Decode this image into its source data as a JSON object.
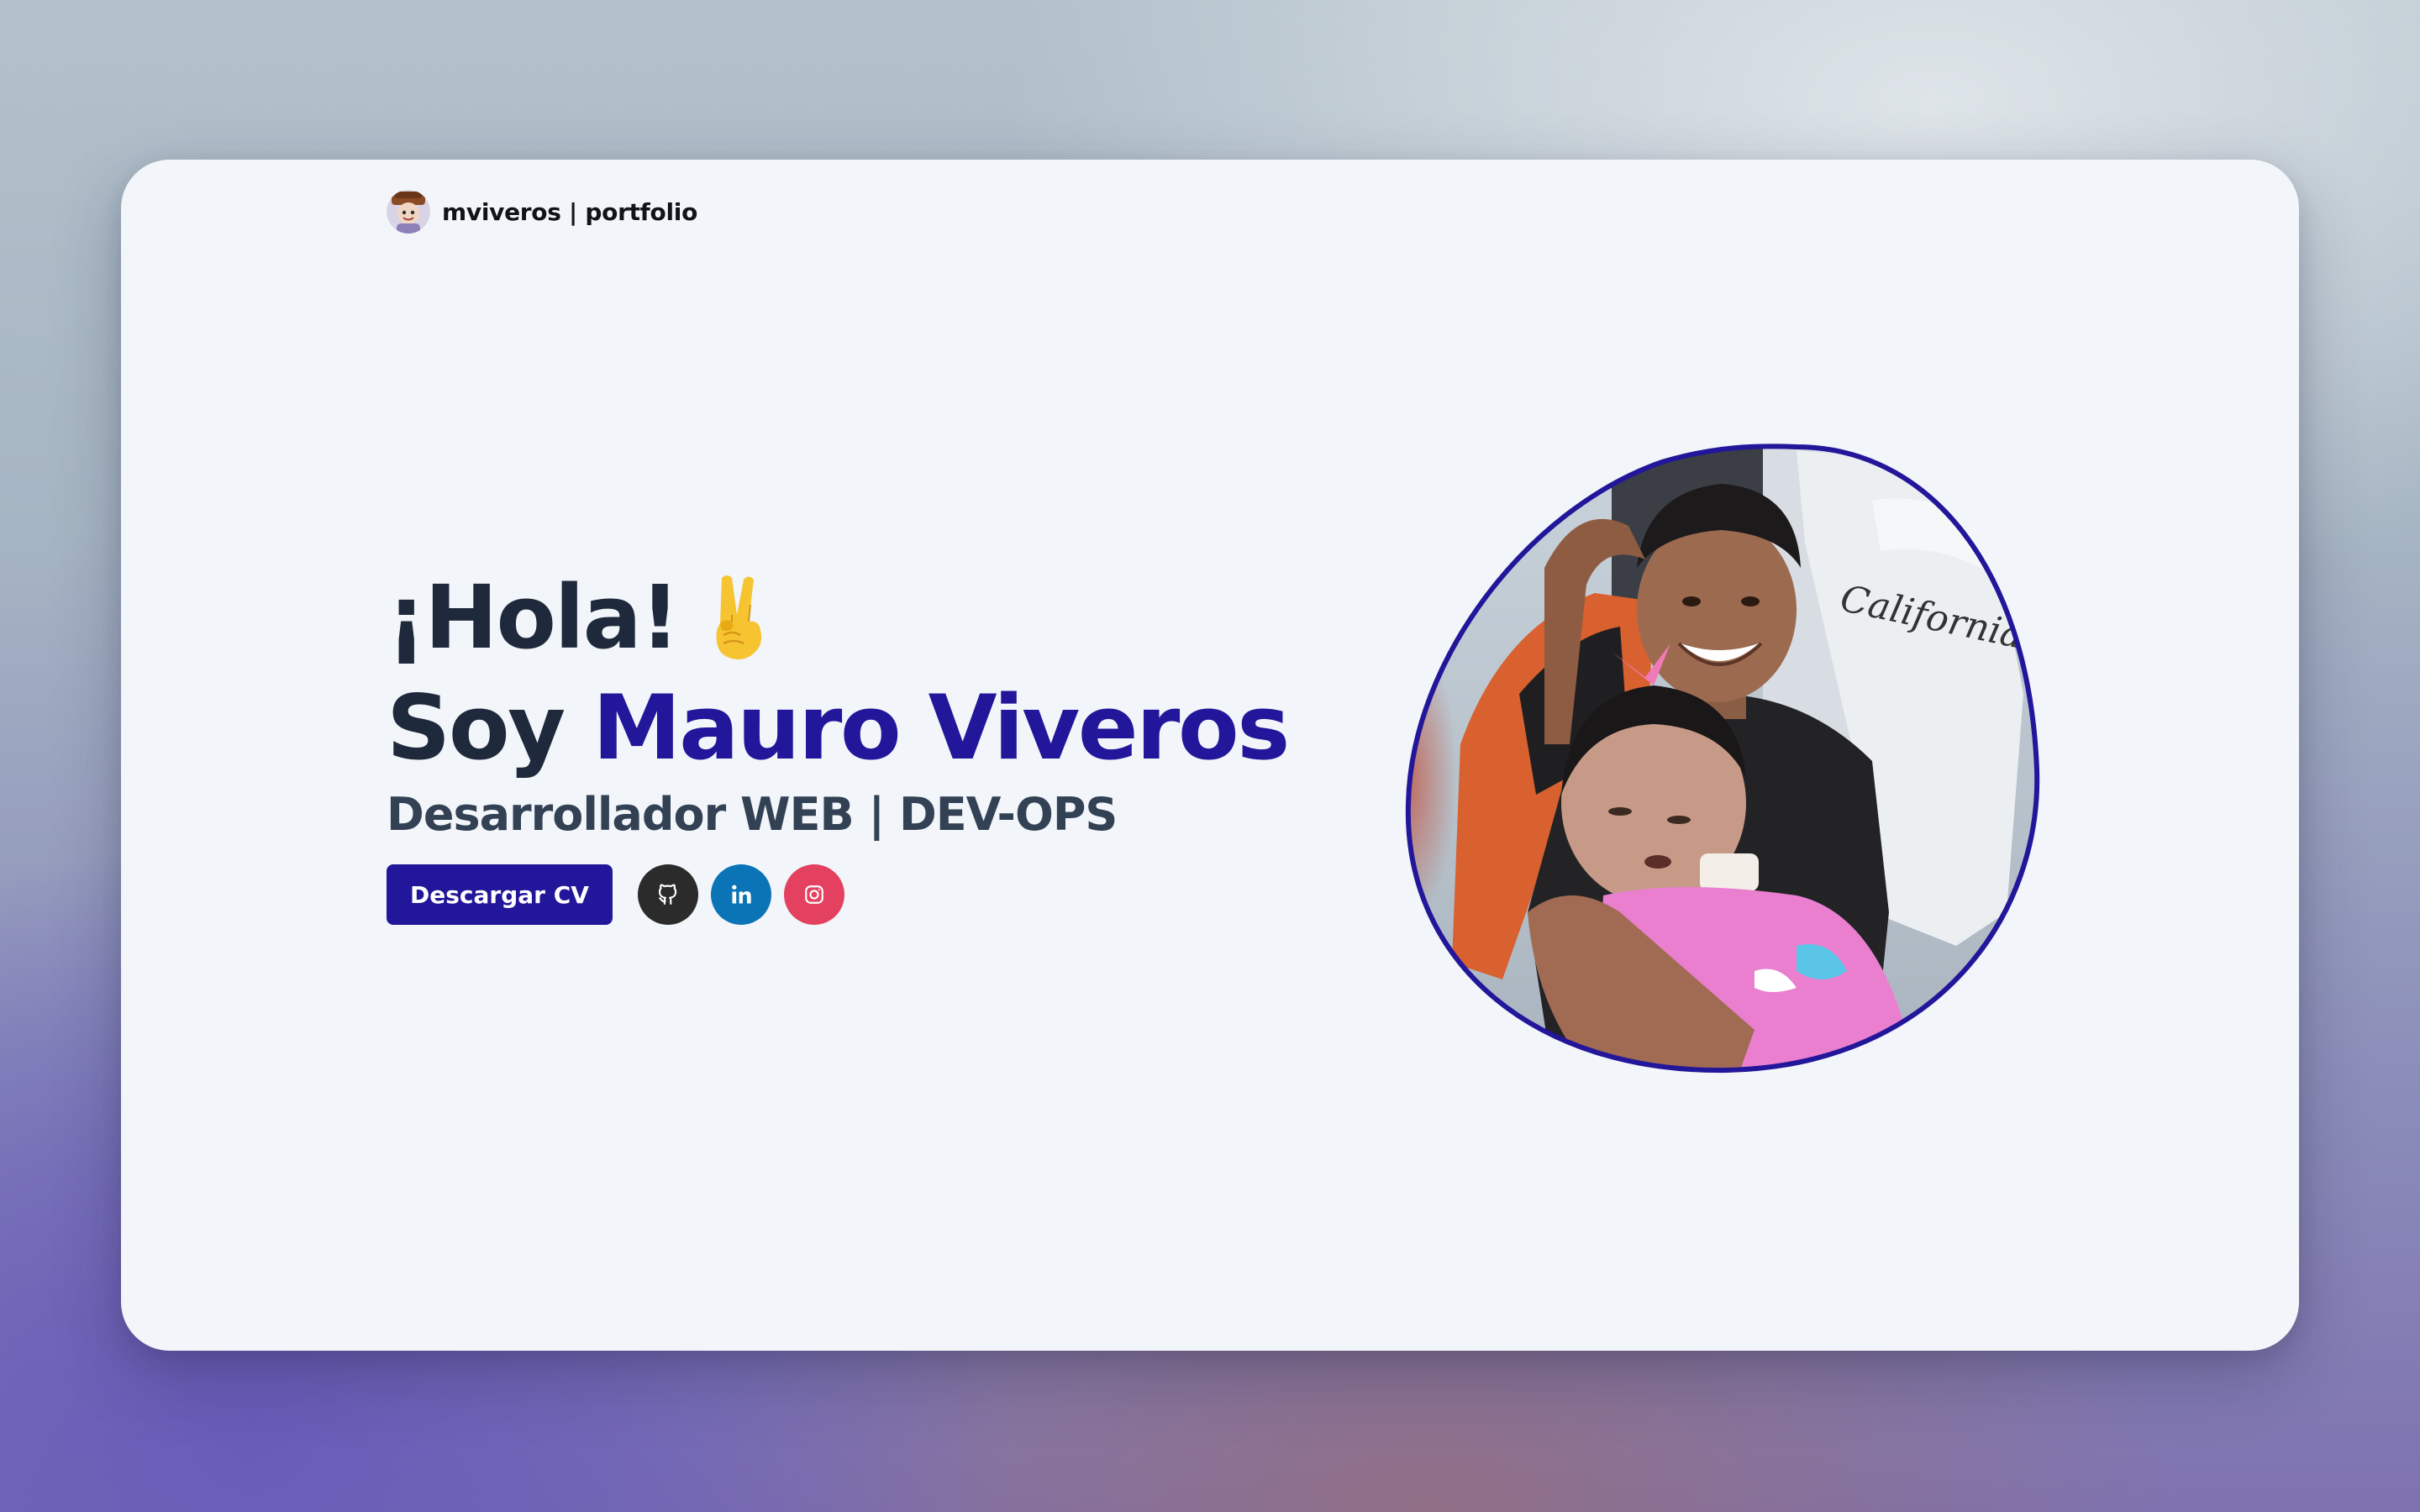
{
  "site": {
    "brand": "mviveros | portfolio",
    "logo_icon": "avatar-logo-icon"
  },
  "hero": {
    "greeting": "¡Hola!",
    "greeting_emoji_icon": "victory-hand-icon",
    "name_prefix": "Soy",
    "name": "Mauro Viveros",
    "role": "Desarrollador WEB | DEV-OPS",
    "cv_button_label": "Descargar CV",
    "socials": [
      {
        "name": "GitHub",
        "icon": "github-icon",
        "color": "#2b2b2b"
      },
      {
        "name": "LinkedIn",
        "icon": "linkedin-icon",
        "color": "#0a74b6"
      },
      {
        "name": "Instagram",
        "icon": "instagram-icon",
        "color": "#e4405f"
      }
    ]
  },
  "profile_photo": {
    "icon": "profile-photo",
    "printed_text": "California"
  },
  "colors": {
    "accent": "#22169a",
    "heading": "#1e293b",
    "subheading": "#334155",
    "card_background": "#f2f5f9"
  }
}
